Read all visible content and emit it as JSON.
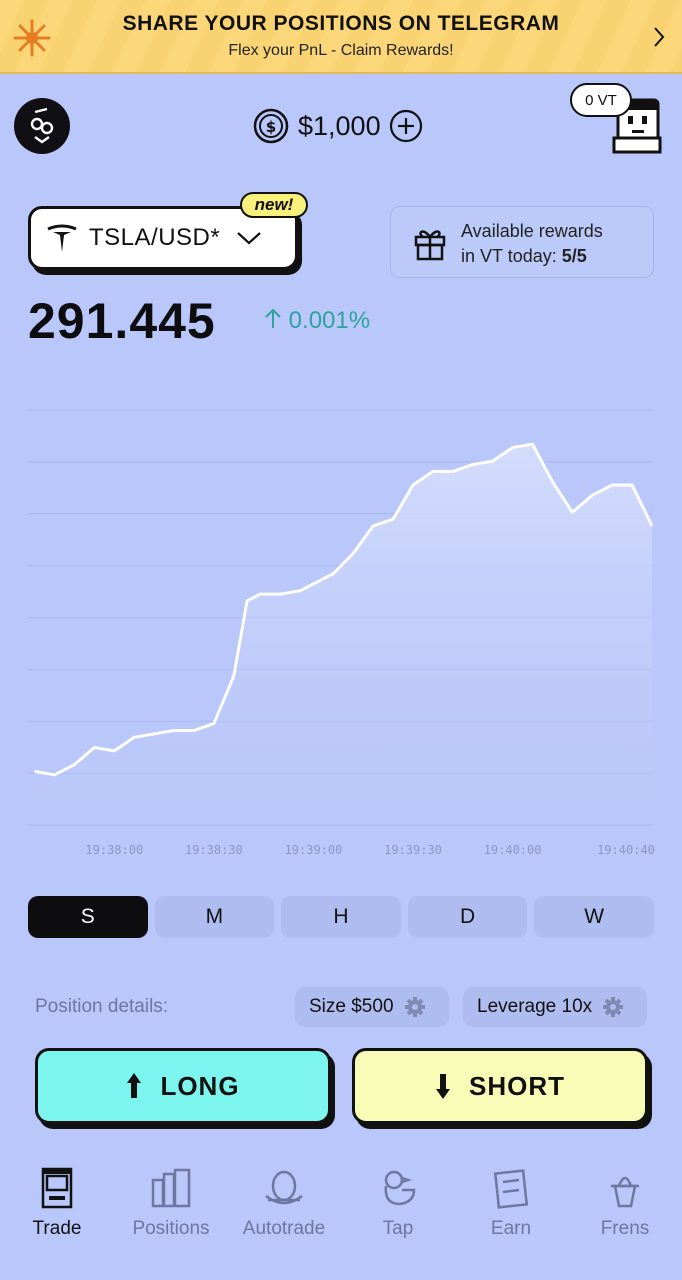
{
  "banner": {
    "title": "SHARE YOUR POSITIONS ON TELEGRAM",
    "subtitle": "Flex your PnL - Claim Rewards!"
  },
  "header": {
    "balance": "$1,000",
    "vt_badge": "0 VT"
  },
  "pair": {
    "symbol": "TSLA/USD*",
    "new_tag": "new!"
  },
  "rewards": {
    "line1": "Available rewards",
    "line2_prefix": "in VT today: ",
    "count": "5/5"
  },
  "price": {
    "value": "291.445",
    "change": "0.001%"
  },
  "chart_data": {
    "type": "area",
    "x_tick_labels": [
      "19:38:00",
      "19:38:30",
      "19:39:00",
      "19:39:30",
      "19:40:00",
      "19:40:40"
    ],
    "x": [
      "19:37:36",
      "19:37:42",
      "19:37:48",
      "19:37:54",
      "19:38:00",
      "19:38:06",
      "19:38:12",
      "19:38:18",
      "19:38:24",
      "19:38:30",
      "19:38:36",
      "19:38:40",
      "19:38:44",
      "19:38:50",
      "19:38:56",
      "19:39:00",
      "19:39:06",
      "19:39:12",
      "19:39:18",
      "19:39:24",
      "19:39:30",
      "19:39:36",
      "19:39:42",
      "19:39:48",
      "19:39:54",
      "19:40:00",
      "19:40:06",
      "19:40:12",
      "19:40:18",
      "19:40:24",
      "19:40:30",
      "19:40:36",
      "19:40:42"
    ],
    "y": [
      0.04,
      0.03,
      0.06,
      0.11,
      0.1,
      0.14,
      0.15,
      0.16,
      0.16,
      0.18,
      0.32,
      0.54,
      0.56,
      0.56,
      0.57,
      0.59,
      0.62,
      0.68,
      0.76,
      0.78,
      0.88,
      0.92,
      0.92,
      0.94,
      0.95,
      0.99,
      1.0,
      0.89,
      0.8,
      0.85,
      0.88,
      0.88,
      0.76
    ],
    "ylim": [
      0,
      1.1
    ],
    "grid": true,
    "color": "#ffffff"
  },
  "timeframes": [
    "S",
    "M",
    "H",
    "D",
    "W"
  ],
  "active_timeframe": "S",
  "position": {
    "label": "Position details:",
    "size": "Size $500",
    "leverage": "Leverage 10x"
  },
  "actions": {
    "long": "LONG",
    "short": "SHORT"
  },
  "nav": [
    {
      "label": "Trade",
      "icon": "arcade-icon"
    },
    {
      "label": "Positions",
      "icon": "folders-icon"
    },
    {
      "label": "Autotrade",
      "icon": "nest-egg-icon"
    },
    {
      "label": "Tap",
      "icon": "bird-icon"
    },
    {
      "label": "Earn",
      "icon": "notepad-icon"
    },
    {
      "label": "Frens",
      "icon": "hat-icon"
    }
  ],
  "colors": {
    "background": "#b9c7fa",
    "long": "#7cf5ef",
    "short": "#f8fcb7",
    "positive": "#2ea39a",
    "banner": "#fbd77a"
  }
}
